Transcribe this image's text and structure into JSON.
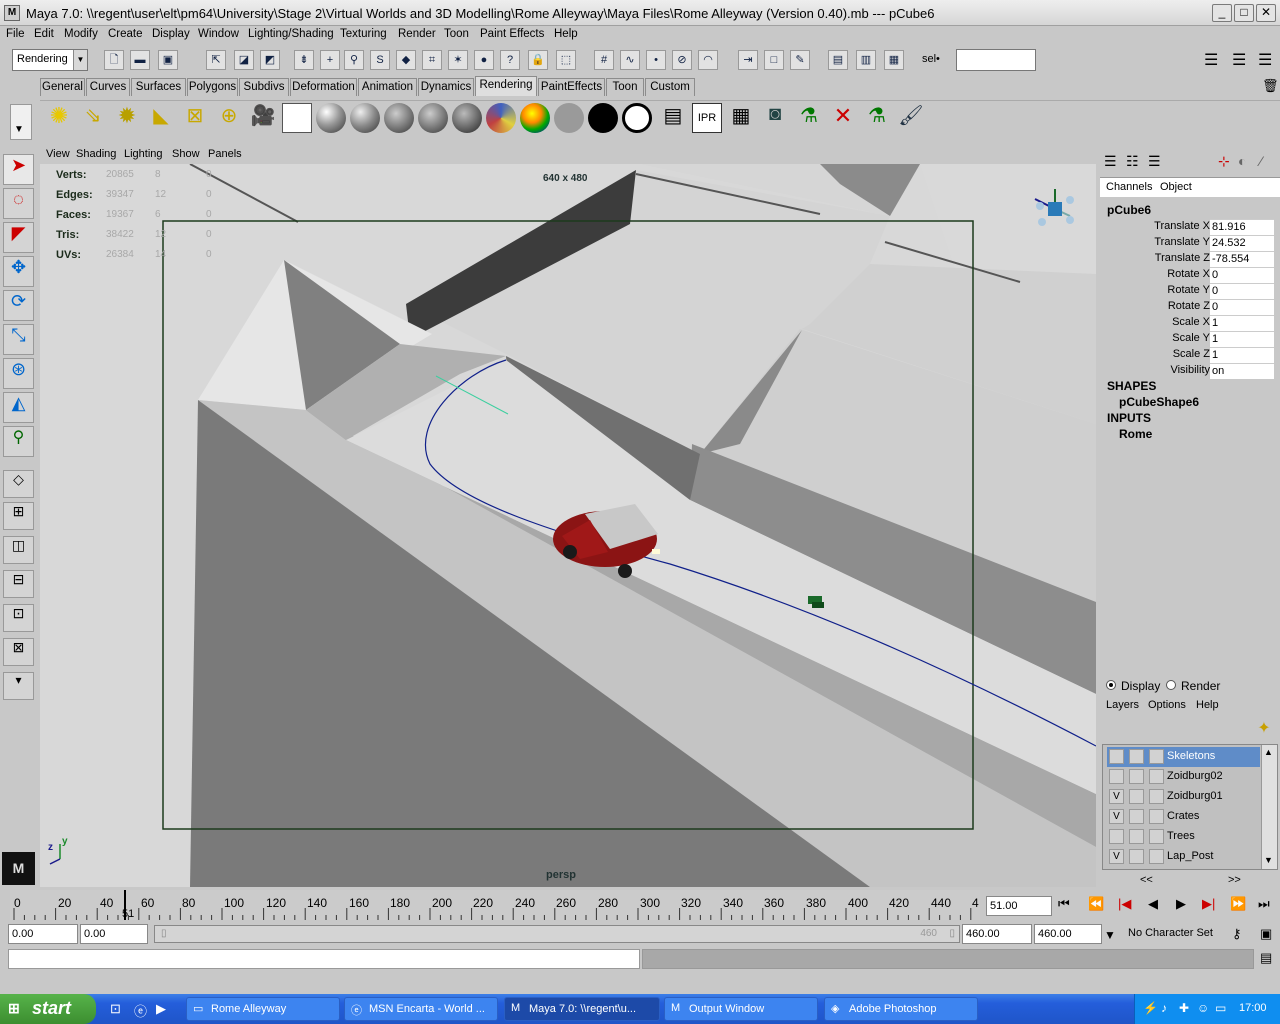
{
  "window": {
    "title": "Maya 7.0: \\\\regent\\user\\elt\\pm64\\University\\Stage 2\\Virtual Worlds and 3D Modelling\\Rome Alleyway\\Maya Files\\Rome Alleyway (Version 0.40).mb   ---   pCube6",
    "app_icon": "M",
    "btn_minimize": "_",
    "btn_maximize": "□",
    "btn_close": "✕"
  },
  "menu": [
    "File",
    "Edit",
    "Modify",
    "Create",
    "Display",
    "Window",
    "Lighting/Shading",
    "Texturing",
    "Render",
    "Toon",
    "Paint Effects",
    "Help"
  ],
  "status_line": {
    "mode": "Rendering",
    "sel_label": "sel•",
    "sel_value": ""
  },
  "shelf_tabs": [
    "General",
    "Curves",
    "Surfaces",
    "Polygons",
    "Subdivs",
    "Deformation",
    "Animation",
    "Dynamics",
    "Rendering",
    "PaintEffects",
    "Toon",
    "Custom"
  ],
  "active_tab": "Rendering",
  "panel_menu": [
    "View",
    "Shading",
    "Lighting",
    "Show",
    "Panels"
  ],
  "hud": {
    "rows": [
      {
        "label": "Verts:",
        "v1": "20865",
        "v2": "8",
        "v3": "0"
      },
      {
        "label": "Edges:",
        "v1": "39347",
        "v2": "12",
        "v3": "0"
      },
      {
        "label": "Faces:",
        "v1": "19367",
        "v2": "6",
        "v3": "0"
      },
      {
        "label": "Tris:",
        "v1": "38422",
        "v2": "12",
        "v3": "0"
      },
      {
        "label": "UVs:",
        "v1": "26384",
        "v2": "14",
        "v3": "0"
      }
    ],
    "resolution": "640 x 480",
    "camera": "persp",
    "axis_z": "z",
    "axis_y": "y"
  },
  "channel_box": {
    "tabs": [
      "Channels",
      "Object"
    ],
    "object": "pCube6",
    "attrs": [
      {
        "label": "Translate X",
        "value": "81.916"
      },
      {
        "label": "Translate Y",
        "value": "24.532"
      },
      {
        "label": "Translate Z",
        "value": "-78.554"
      },
      {
        "label": "Rotate X",
        "value": "0"
      },
      {
        "label": "Rotate Y",
        "value": "0"
      },
      {
        "label": "Rotate Z",
        "value": "0"
      },
      {
        "label": "Scale X",
        "value": "1"
      },
      {
        "label": "Scale Y",
        "value": "1"
      },
      {
        "label": "Scale Z",
        "value": "1"
      },
      {
        "label": "Visibility",
        "value": "on"
      }
    ],
    "shapes_header": "SHAPES",
    "shape": "pCubeShape6",
    "inputs_header": "INPUTS",
    "input": "Rome"
  },
  "layers": {
    "display_label": "Display",
    "render_label": "Render",
    "menu": [
      "Layers",
      "Options",
      "Help"
    ],
    "items": [
      {
        "name": "Skeletons",
        "v": "",
        "selected": true
      },
      {
        "name": "Zoidburg02",
        "v": "",
        "selected": false
      },
      {
        "name": "Zoidburg01",
        "v": "V",
        "selected": false
      },
      {
        "name": "Crates",
        "v": "V",
        "selected": false
      },
      {
        "name": "Trees",
        "v": "",
        "selected": false
      },
      {
        "name": "Lap_Post",
        "v": "V",
        "selected": false
      }
    ],
    "scroll_left": "<<",
    "scroll_right": ">>"
  },
  "timeline": {
    "ticks": [
      "0",
      "20",
      "40",
      "60",
      "80",
      "100",
      "120",
      "140",
      "160",
      "180",
      "200",
      "220",
      "240",
      "260",
      "280",
      "300",
      "320",
      "340",
      "360",
      "380",
      "400",
      "420",
      "440",
      "4"
    ],
    "current_marker": "51",
    "current_frame": "51.00"
  },
  "range": {
    "start": "0.00",
    "playback_start": "0.00",
    "range_end_label": "460",
    "playback_end": "460.00",
    "end": "460.00",
    "character_set": "No Character Set"
  },
  "taskbar": {
    "start": "start",
    "buttons": [
      "Rome Alleyway",
      "MSN Encarta - World ...",
      "Maya 7.0: \\\\regent\\u...",
      "Output Window",
      "Adobe Photoshop"
    ],
    "active_index": 2,
    "clock": "17:00"
  }
}
